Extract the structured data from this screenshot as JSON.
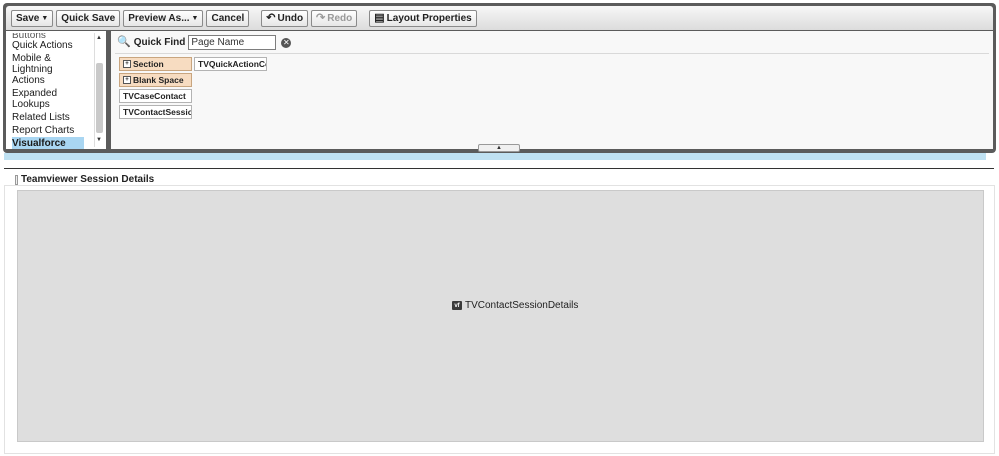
{
  "toolbar": {
    "save": "Save",
    "quick_save": "Quick Save",
    "preview_as": "Preview As...",
    "cancel": "Cancel",
    "undo": "Undo",
    "redo": "Redo",
    "layout_properties": "Layout Properties"
  },
  "palette_categories": {
    "items": [
      "Buttons",
      "Quick Actions",
      "Mobile & Lightning Actions",
      "Expanded Lookups",
      "Related Lists",
      "Report Charts",
      "Visualforce Pages"
    ],
    "selected": "Visualforce Pages"
  },
  "quick_find": {
    "label": "Quick Find",
    "value": "Page Name"
  },
  "palette_fields": {
    "section": "Section",
    "blank_space": "Blank Space",
    "tv_case_contact": "TVCaseContact",
    "tv_contact_session": "TVContactSessionD...",
    "tv_quick_action_contact": "TVQuickActionContact"
  },
  "canvas": {
    "section_title": "Teamviewer Session Details",
    "vf_badge": "vf",
    "vf_page_name": "TVContactSessionDetails"
  },
  "colors": {
    "selected_item": "#a9d6f2",
    "special_chip": "#f7dcc1",
    "band": "#bfe1f2",
    "canvas_fill": "#dedede"
  }
}
